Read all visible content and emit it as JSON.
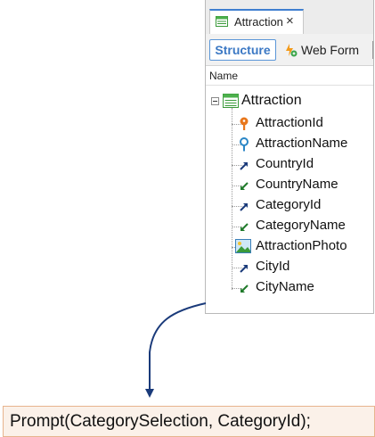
{
  "tab": {
    "title": "Attraction",
    "close_glyph": "×",
    "icon": "transaction-grid-icon"
  },
  "toolbar": {
    "structure_label": "Structure",
    "webform_label": "Web Form",
    "webform_icon": "web-form-icon"
  },
  "tree": {
    "column_header": "Name",
    "root": {
      "label": "Attraction",
      "icon": "transaction-grid-icon"
    },
    "attributes": [
      {
        "label": "AttractionId",
        "icon": "primary-key-icon"
      },
      {
        "label": "AttractionName",
        "icon": "description-key-icon"
      },
      {
        "label": "CountryId",
        "icon": "foreign-key-icon"
      },
      {
        "label": "CountryName",
        "icon": "inferred-attribute-icon"
      },
      {
        "label": "CategoryId",
        "icon": "foreign-key-icon"
      },
      {
        "label": "CategoryName",
        "icon": "inferred-attribute-icon"
      },
      {
        "label": "AttractionPhoto",
        "icon": "image-icon"
      },
      {
        "label": "CityId",
        "icon": "foreign-key-icon"
      },
      {
        "label": "CityName",
        "icon": "inferred-attribute-icon"
      }
    ]
  },
  "code": {
    "prompt_statement": "Prompt(CategorySelection, CategoryId);"
  },
  "colors": {
    "structure_blue": "#3b78c4",
    "key_orange": "#e8771c",
    "key_blue": "#2a86c6",
    "link_arrow": "#1a3a7a",
    "prompt_bg": "#fbf1e9",
    "prompt_border": "#e7b48e"
  }
}
